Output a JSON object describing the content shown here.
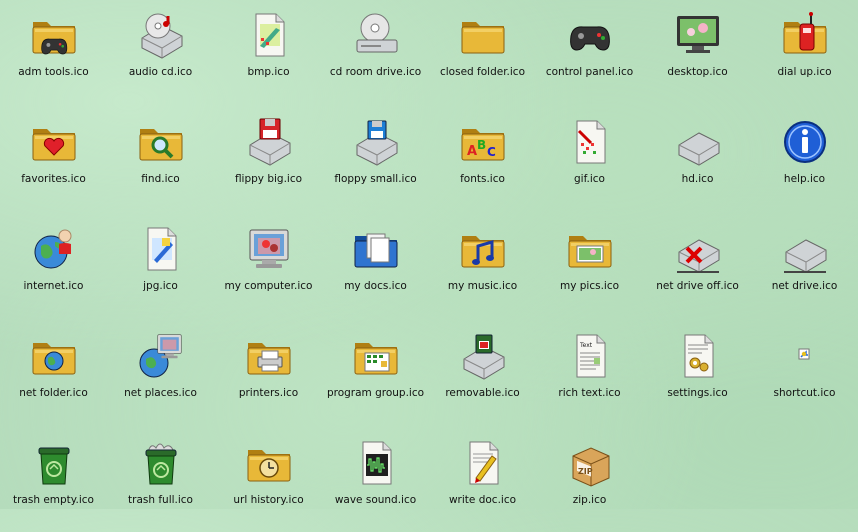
{
  "desktop": {
    "items": [
      {
        "label": "adm tools.ico",
        "icon": "folder-gamepad-icon"
      },
      {
        "label": "audio cd.ico",
        "icon": "audio-cd-icon"
      },
      {
        "label": "bmp.ico",
        "icon": "bmp-file-icon"
      },
      {
        "label": "cd room drive.ico",
        "icon": "cd-drive-icon"
      },
      {
        "label": "closed folder.ico",
        "icon": "closed-folder-icon"
      },
      {
        "label": "control panel.ico",
        "icon": "gamepad-icon"
      },
      {
        "label": "desktop.ico",
        "icon": "desktop-monitor-icon"
      },
      {
        "label": "dial up.ico",
        "icon": "folder-phone-icon"
      },
      {
        "label": "favorites.ico",
        "icon": "folder-heart-icon"
      },
      {
        "label": "find.ico",
        "icon": "folder-magnifier-icon"
      },
      {
        "label": "flippy big.ico",
        "icon": "floppy-drive-big-icon"
      },
      {
        "label": "floppy small.ico",
        "icon": "floppy-drive-small-icon"
      },
      {
        "label": "fonts.ico",
        "icon": "folder-abc-icon"
      },
      {
        "label": "gif.ico",
        "icon": "gif-file-icon"
      },
      {
        "label": "hd.ico",
        "icon": "hard-drive-icon"
      },
      {
        "label": "help.ico",
        "icon": "help-info-icon"
      },
      {
        "label": "internet.ico",
        "icon": "globe-person-icon"
      },
      {
        "label": "jpg.ico",
        "icon": "jpg-file-icon"
      },
      {
        "label": "my computer.ico",
        "icon": "computer-monitor-icon"
      },
      {
        "label": "my docs.ico",
        "icon": "blue-docs-folder-icon"
      },
      {
        "label": "my music.ico",
        "icon": "folder-music-icon"
      },
      {
        "label": "my pics.ico",
        "icon": "folder-pictures-icon"
      },
      {
        "label": "net drive off.ico",
        "icon": "net-drive-off-icon"
      },
      {
        "label": "net drive.ico",
        "icon": "net-drive-icon"
      },
      {
        "label": "net folder.ico",
        "icon": "folder-globe-icon"
      },
      {
        "label": "net places.ico",
        "icon": "net-places-icon"
      },
      {
        "label": "printers.ico",
        "icon": "folder-printer-icon"
      },
      {
        "label": "program group.ico",
        "icon": "folder-program-group-icon"
      },
      {
        "label": "removable.ico",
        "icon": "removable-drive-icon"
      },
      {
        "label": "rich text.ico",
        "icon": "rich-text-file-icon"
      },
      {
        "label": "settings.ico",
        "icon": "settings-file-icon"
      },
      {
        "label": "shortcut.ico",
        "icon": "shortcut-icon"
      },
      {
        "label": "trash empty.ico",
        "icon": "trash-empty-icon"
      },
      {
        "label": "trash full.ico",
        "icon": "trash-full-icon"
      },
      {
        "label": "url history.ico",
        "icon": "folder-clock-icon"
      },
      {
        "label": "wave sound.ico",
        "icon": "wave-sound-file-icon"
      },
      {
        "label": "write doc.ico",
        "icon": "write-doc-icon"
      },
      {
        "label": "zip.ico",
        "icon": "zip-box-icon"
      }
    ]
  },
  "colors": {
    "background": "#b5dcbc",
    "folder": "#e8b838",
    "folder_dark": "#b07f12",
    "drive": "#cfd3d6",
    "trash": "#2e8b2e",
    "help_blue": "#1f5fd6"
  }
}
